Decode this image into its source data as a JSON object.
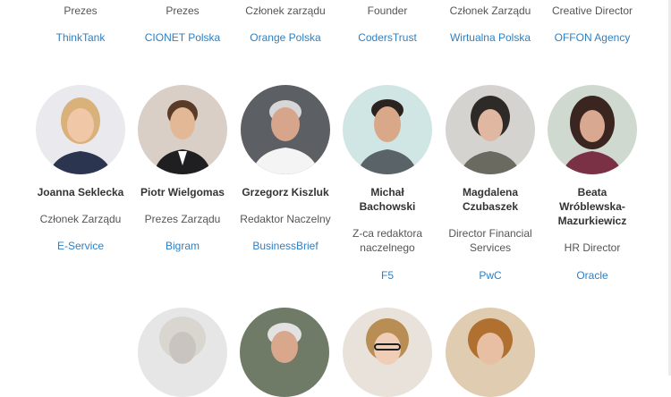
{
  "top_row": [
    {
      "role": "Prezes",
      "company": "ThinkTank"
    },
    {
      "role": "Prezes",
      "company": "CIONET Polska"
    },
    {
      "role": "Członek zarządu",
      "company": "Orange Polska"
    },
    {
      "role": "Founder",
      "company": "CodersTrust"
    },
    {
      "role": "Członek Zarządu",
      "company": "Wirtualna Polska"
    },
    {
      "role": "Creative Director",
      "company": "OFFON Agency"
    }
  ],
  "people": [
    {
      "name_lines": [
        "Joanna Seklecka"
      ],
      "role_lines": [
        "Członek Zarządu"
      ],
      "company": "E-Service"
    },
    {
      "name_lines": [
        "Piotr Wielgomas"
      ],
      "role_lines": [
        "Prezes Zarządu"
      ],
      "company": "Bigram"
    },
    {
      "name_lines": [
        "Grzegorz Kiszluk"
      ],
      "role_lines": [
        "Redaktor Naczelny"
      ],
      "company": "BusinessBrief"
    },
    {
      "name_lines": [
        "Michał",
        "Bachowski"
      ],
      "role_lines": [
        "Z-ca redaktora",
        "naczelnego"
      ],
      "company": "F5"
    },
    {
      "name_lines": [
        "Magdalena",
        "Czubaszek"
      ],
      "role_lines": [
        "Director Financial",
        "Services"
      ],
      "company": "PwC"
    },
    {
      "name_lines": [
        "Beata",
        "Wróblewska-",
        "Mazurkiewicz"
      ],
      "role_lines": [
        "HR Director"
      ],
      "company": "Oracle"
    }
  ],
  "colors": {
    "link": "#2f7fc1",
    "name": "#333333",
    "role": "#555555"
  }
}
